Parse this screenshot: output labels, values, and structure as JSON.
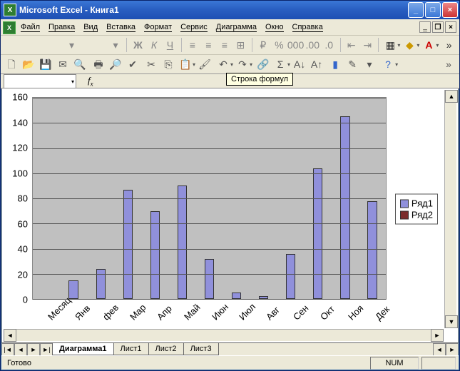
{
  "title": "Microsoft Excel - Книга1",
  "menu": [
    "Файл",
    "Правка",
    "Вид",
    "Вставка",
    "Формат",
    "Сервис",
    "Диаграмма",
    "Окно",
    "Справка"
  ],
  "tooltip": "Строка формул",
  "tabs": {
    "active": "Диаграмма1",
    "others": [
      "Лист1",
      "Лист2",
      "Лист3"
    ]
  },
  "status": {
    "ready": "Готово",
    "num": "NUM"
  },
  "legend": {
    "s1": "Ряд1",
    "s2": "Ряд2"
  },
  "colors": {
    "series1": "#9090db",
    "series2": "#7b2d2d",
    "plot_bg": "#c0c0c0"
  },
  "chart_data": {
    "type": "bar",
    "categories": [
      "Месяц",
      "Янв",
      "фев",
      "Map",
      "Апр",
      "Май",
      "Июн",
      "Июл",
      "Авг",
      "Сен",
      "Окт",
      "Ноя",
      "Дек"
    ],
    "series": [
      {
        "name": "Ряд1",
        "values": [
          0,
          15,
          24,
          87,
          70,
          90,
          32,
          5,
          2,
          36,
          104,
          145,
          78
        ]
      },
      {
        "name": "Ряд2",
        "values": [
          0,
          0,
          0,
          0,
          0,
          0,
          0,
          0,
          0,
          0,
          0,
          0,
          0
        ]
      }
    ],
    "ylim": [
      0,
      160
    ],
    "yticks": [
      0,
      20,
      40,
      60,
      80,
      100,
      120,
      140,
      160
    ],
    "xlabel": "",
    "ylabel": "",
    "title": ""
  }
}
